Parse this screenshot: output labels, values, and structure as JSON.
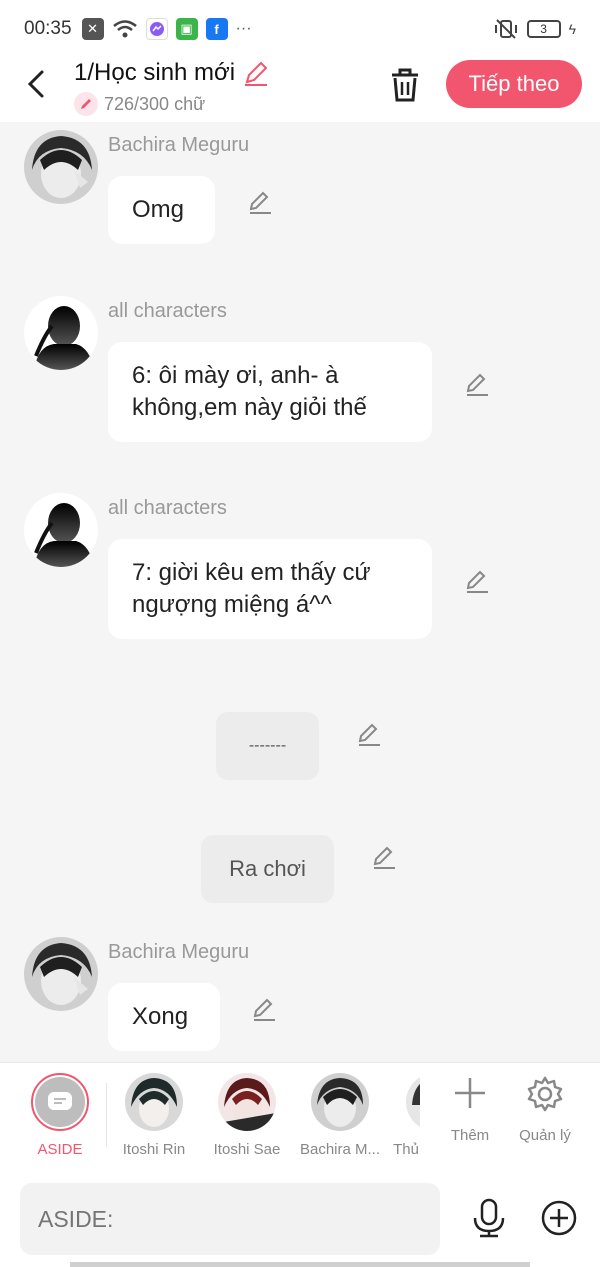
{
  "status_bar": {
    "time": "00:35",
    "battery_level": "3",
    "more_indicator": "···"
  },
  "header": {
    "title": "1/Học sinh mới",
    "word_count": "726/300 chữ",
    "next_label": "Tiếp theo"
  },
  "messages": [
    {
      "type": "character",
      "name": "Bachira Meguru",
      "text": "Omg"
    },
    {
      "type": "character",
      "name": "all characters",
      "text": "6: ôi mày ơi, anh- à không,em này giỏi thế"
    },
    {
      "type": "character",
      "name": "all characters",
      "text": "7: giời kêu em thấy cứ ngượng miệng á^^"
    },
    {
      "type": "narration",
      "text": "-------"
    },
    {
      "type": "narration",
      "text": "Ra chơi"
    },
    {
      "type": "character",
      "name": "Bachira Meguru",
      "text": "Xong"
    }
  ],
  "character_bar": {
    "characters": [
      {
        "name": "ASIDE",
        "selected": true
      },
      {
        "name": "Itoshi Rin"
      },
      {
        "name": "Itoshi Sae"
      },
      {
        "name": "Bachira M..."
      },
      {
        "name": "Thủ"
      }
    ],
    "add_label": "Thêm",
    "manage_label": "Quản lý"
  },
  "composer": {
    "placeholder": "ASIDE:"
  },
  "colors": {
    "accent": "#f2566e",
    "background": "#f5f5f5",
    "bubble": "#ffffff",
    "narration_bg": "#ececec"
  }
}
